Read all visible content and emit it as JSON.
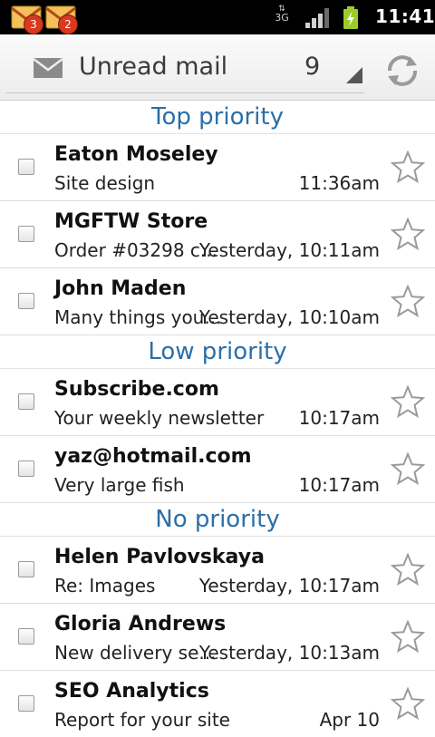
{
  "status_bar": {
    "notifications": [
      {
        "icon": "gmail-icon",
        "count": "3"
      },
      {
        "icon": "gmail-icon",
        "count": "2"
      }
    ],
    "network": "3G",
    "time": "11:41"
  },
  "header": {
    "icon": "envelope-icon",
    "title": "Unread mail",
    "count": "9",
    "sync_icon": "sync-icon"
  },
  "sections": [
    {
      "label": "Top priority",
      "rows": [
        {
          "sender": "Eaton Moseley",
          "subject": "Site design",
          "date": "11:36am"
        },
        {
          "sender": "MGFTW Store",
          "subject": "Order #03298 c...",
          "date": "Yesterday, 10:11am"
        },
        {
          "sender": "John Maden",
          "subject": "Many things you...",
          "date": "Yesterday, 10:10am"
        }
      ]
    },
    {
      "label": "Low priority",
      "rows": [
        {
          "sender": "Subscribe.com",
          "subject": "Your weekly newsletter",
          "date": "10:17am"
        },
        {
          "sender": "yaz@hotmail.com",
          "subject": "Very large fish",
          "date": "10:17am"
        }
      ]
    },
    {
      "label": "No priority",
      "rows": [
        {
          "sender": "Helen Pavlovskaya",
          "subject": "Re: Images",
          "date": "Yesterday, 10:17am"
        },
        {
          "sender": "Gloria Andrews",
          "subject": "New delivery se...",
          "date": "Yesterday, 10:13am"
        },
        {
          "sender": "SEO Analytics",
          "subject": "Report for your site",
          "date": "Apr 10"
        }
      ]
    }
  ],
  "colors": {
    "section_label": "#2a6fa8",
    "badge": "#d9391f"
  }
}
